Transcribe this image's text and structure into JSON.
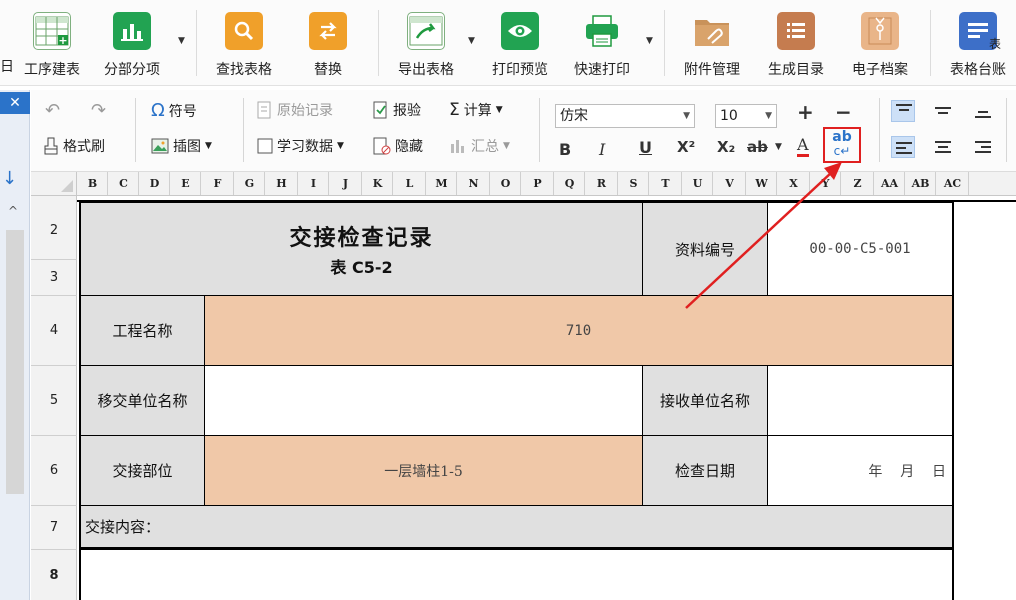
{
  "ribbon": {
    "partial_left_label": "日",
    "buttons": [
      {
        "label": "工序建表",
        "icon": "table-add-icon"
      },
      {
        "label": "分部分项",
        "icon": "bar-chart-icon"
      },
      {
        "label": "查找表格",
        "icon": "search-icon"
      },
      {
        "label": "替换",
        "icon": "swap-icon"
      },
      {
        "label": "导出表格",
        "icon": "export-icon"
      },
      {
        "label": "打印预览",
        "icon": "eye-icon"
      },
      {
        "label": "快速打印",
        "icon": "printer-icon"
      },
      {
        "label": "附件管理",
        "icon": "attachment-folder-icon"
      },
      {
        "label": "生成目录",
        "icon": "list-icon"
      },
      {
        "label": "电子档案",
        "icon": "archive-envelope-icon"
      },
      {
        "label": "表格台账",
        "icon": "ledger-icon"
      }
    ],
    "ledger_badge": "表"
  },
  "left_panel": {
    "close_glyph": "✕",
    "arrow_glyph": "↓",
    "up_glyph": "^"
  },
  "format_toolbar": {
    "undo_glyph": "↶",
    "redo_glyph": "↷",
    "symbol_label": "符号",
    "symbol_glyph": "Ω",
    "format_brush_label": "格式刷",
    "insert_image_label": "插图",
    "original_record_label": "原始记录",
    "inspection_label": "报验",
    "calculate_label": "计算",
    "sigma_glyph": "Σ",
    "learning_data_label": "学习数据",
    "hide_label": "隐藏",
    "summary_label": "汇总",
    "font_family": "仿宋",
    "font_size": "10",
    "plus_glyph": "+",
    "minus_glyph": "−",
    "bold_glyph": "B",
    "italic_glyph": "I",
    "underline_glyph": "U",
    "superscript_glyph": "X²",
    "subscript_glyph": "X₂",
    "strike_glyph": "ab",
    "font_color_glyph": "A",
    "wrap_text_glyph_top": "ab",
    "wrap_text_glyph_bottom": "c↵",
    "font_color_accent": "#e02020",
    "highlight_color": "#e02020"
  },
  "columns": [
    "B",
    "C",
    "D",
    "E",
    "F",
    "G",
    "H",
    "I",
    "J",
    "K",
    "L",
    "M",
    "N",
    "O",
    "P",
    "Q",
    "R",
    "S",
    "T",
    "U",
    "V",
    "W",
    "X",
    "Y",
    "Z",
    "AA",
    "AB",
    "AC"
  ],
  "rows": [
    "2",
    "3",
    "4",
    "5",
    "6",
    "7",
    "8"
  ],
  "form": {
    "title": "交接检查记录",
    "subtitle": "表 C5-2",
    "doc_no_label": "资料编号",
    "doc_no_value": "00-00-C5-001",
    "project_name_label": "工程名称",
    "project_name_value": "710",
    "transfer_unit_label": "移交单位名称",
    "transfer_unit_value": "",
    "receive_unit_label": "接收单位名称",
    "receive_unit_value": "",
    "handover_part_label": "交接部位",
    "handover_part_value": "一层墙柱1-5",
    "check_date_label": "检查日期",
    "check_date_value": "年    月    日",
    "handover_content_label": "交接内容："
  }
}
